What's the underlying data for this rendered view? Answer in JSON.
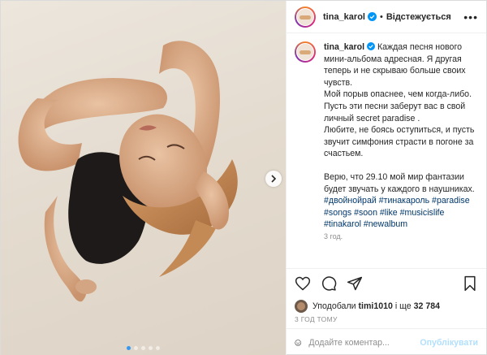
{
  "header": {
    "username": "tina_karol",
    "separator": "•",
    "follow_label": "Відстежується",
    "more_label": "•••"
  },
  "caption": {
    "username": "tina_karol",
    "lines": [
      "Каждая песня нового",
      "мини-альбома адресная. Я другая",
      "теперь и не скрываю больше своих",
      "чувств.",
      "Мой порыв опаснее, чем когда-либо.",
      "Пусть эти песни заберут вас в свой",
      "личный secret paradise .",
      "Любите, не боясь оступиться, и пусть",
      "звучит симфония страсти в погоне за",
      "счастьем."
    ],
    "lines2": [
      "Верю, что 29.10 мой мир фантазии",
      "будет звучать у каждого в наушниках."
    ],
    "tags": [
      "#двойнойрай #тинакароль #paradise",
      "#songs #soon #like #musicislife",
      "#tinakarol #newalbum"
    ],
    "time": "3 год."
  },
  "likes": {
    "prefix": "Уподобали",
    "user": "timi1010",
    "middle": "і ще",
    "count": "32 784"
  },
  "timestamp": "3 ГОД ТОМУ",
  "comment": {
    "placeholder": "Додайте коментар...",
    "publish_label": "Опублікувати"
  },
  "icons": {
    "verified": "verified-badge-icon",
    "like": "heart-icon",
    "comment": "comment-icon",
    "share": "send-icon",
    "save": "bookmark-icon",
    "emoji": "smiley-icon",
    "next": "chevron-right-icon"
  },
  "colors": {
    "accent": "#3897f0",
    "verified": "#0095f6",
    "publish_disabled": "#b2dffc",
    "hashtag": "#00376b"
  },
  "carousel": {
    "slide_count": 5,
    "active_index": 0
  }
}
